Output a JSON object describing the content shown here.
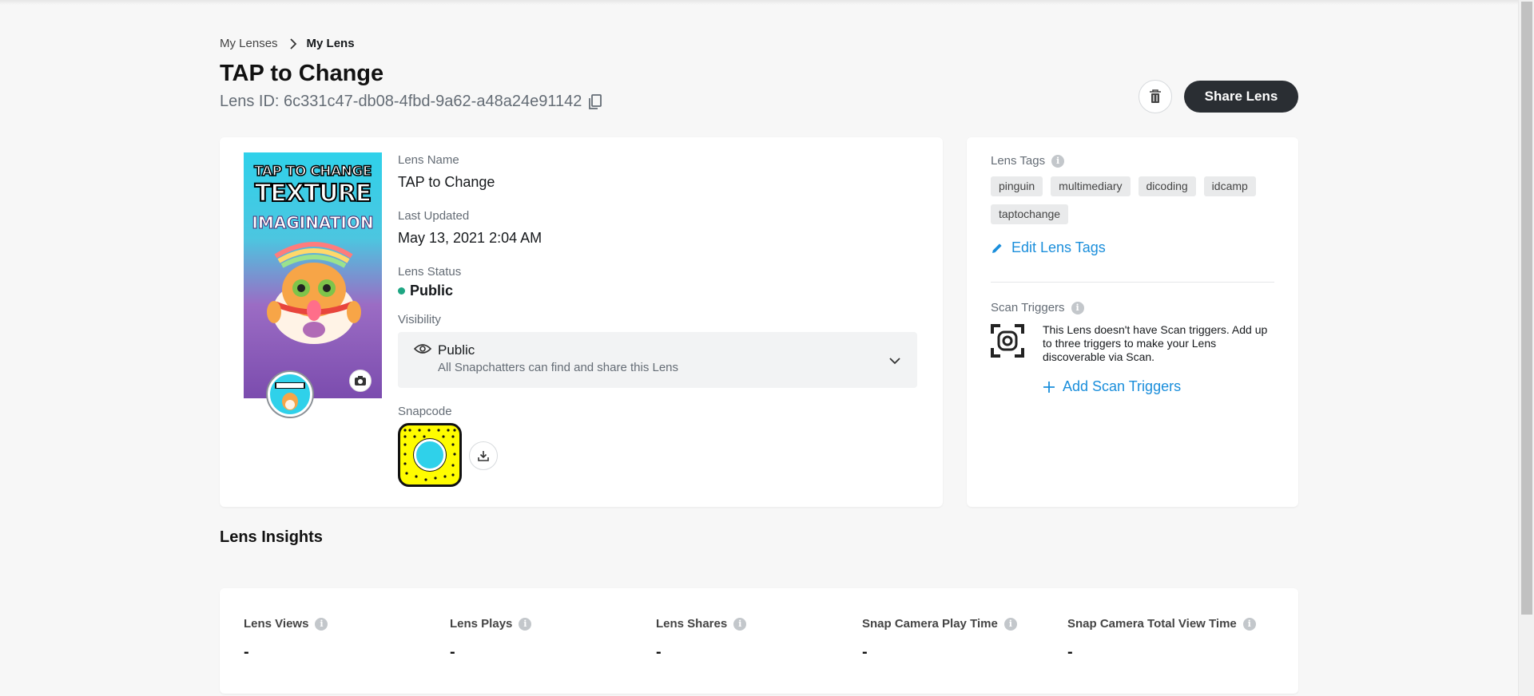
{
  "breadcrumb": {
    "parent": "My Lenses",
    "current": "My Lens"
  },
  "lens": {
    "title": "TAP to Change",
    "id_text": "Lens ID: 6c331c47-db08-4fbd-9a62-a48a24e91142"
  },
  "actions": {
    "share_label": "Share Lens"
  },
  "thumbnail": {
    "line1": "TAP TO CHANGE",
    "line2": "TEXTURE",
    "line3": "IMAGINATION"
  },
  "details": {
    "name_label": "Lens Name",
    "name_value": "TAP to Change",
    "updated_label": "Last Updated",
    "updated_value": "May 13, 2021 2:04 AM",
    "status_label": "Lens Status",
    "status_value": "Public",
    "visibility_label": "Visibility",
    "visibility_value": "Public",
    "visibility_desc": "All Snapchatters can find and share this Lens",
    "snapcode_label": "Snapcode"
  },
  "tags": {
    "label": "Lens Tags",
    "items": [
      "pinguin",
      "multimediary",
      "dicoding",
      "idcamp",
      "taptochange"
    ],
    "edit_label": "Edit Lens Tags"
  },
  "scan": {
    "label": "Scan Triggers",
    "text": "This Lens doesn't have Scan triggers. Add up to three triggers to make your Lens discoverable via Scan.",
    "add_label": "Add Scan Triggers"
  },
  "insights": {
    "title": "Lens Insights",
    "metrics": [
      {
        "label": "Lens Views",
        "value": "-"
      },
      {
        "label": "Lens Plays",
        "value": "-"
      },
      {
        "label": "Lens Shares",
        "value": "-"
      },
      {
        "label": "Snap Camera Play Time",
        "value": "-"
      },
      {
        "label": "Snap Camera Total View Time",
        "value": "-"
      }
    ]
  },
  "colors": {
    "accent_link": "#1a8edb",
    "status_public": "#1ea683",
    "primary_button": "#2a2e33"
  }
}
